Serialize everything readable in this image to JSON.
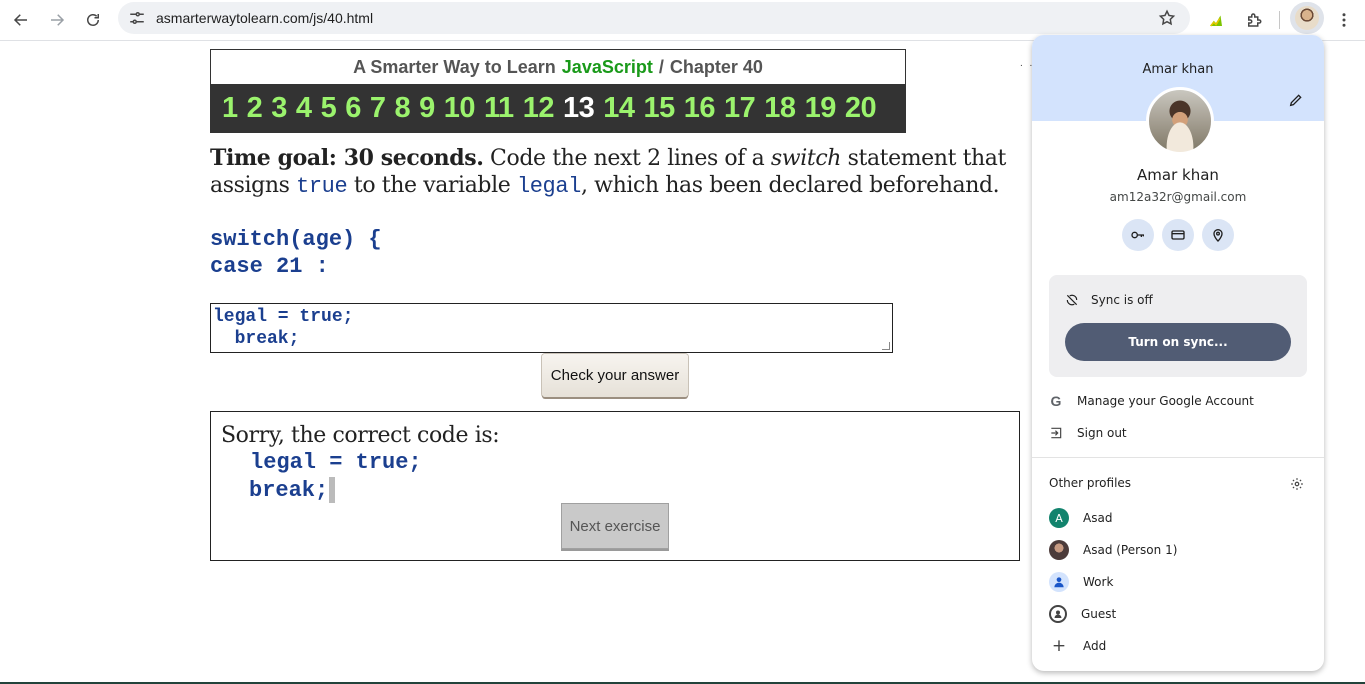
{
  "browser": {
    "url": "asmarterwaytolearn.com/js/40.html",
    "icons": [
      "back-icon",
      "forward-icon",
      "reload-icon",
      "site-info-icon",
      "bookmark-star-icon",
      "extension-icon",
      "puzzle-icon",
      "profile-avatar",
      "kebab-menu-icon"
    ]
  },
  "page": {
    "banner": {
      "prefix": "A Smarter Way to Learn",
      "highlight": "JavaScript",
      "separator": "/",
      "chapter": "Chapter 40"
    },
    "chapters": [
      "1",
      "2",
      "3",
      "4",
      "5",
      "6",
      "7",
      "8",
      "9",
      "10",
      "11",
      "12",
      "13",
      "14",
      "15",
      "16",
      "17",
      "18",
      "19",
      "20"
    ],
    "current_chapter": "13",
    "instructions": {
      "goal": "Time goal: 30 seconds.",
      "text1": " Code the next 2 lines of a ",
      "italic": "switch",
      "text2": " statement that assigns ",
      "code1": "true",
      "text3": " to the variable ",
      "code2": "legal",
      "text4": ", which has been declared beforehand."
    },
    "code_lines": [
      "switch(age) {",
      "case 21 :"
    ],
    "answer": {
      "line1": "legal = true;",
      "line2": "  break;"
    },
    "check_button": "Check your answer",
    "feedback": {
      "sorry": "Sorry, the correct code is:",
      "line1": "legal = true;",
      "line2": "break;",
      "next_button": "Next exercise"
    },
    "dots": ". . ."
  },
  "profile_panel": {
    "header_name": "Amar khan",
    "name": "Amar khan",
    "email": "am12a32r@gmail.com",
    "quick_actions": [
      "password-key-icon",
      "payment-card-icon",
      "address-pin-icon"
    ],
    "sync_status": "Sync is off",
    "sync_button": "Turn on sync...",
    "manage_account": "Manage your Google Account",
    "sign_out": "Sign out",
    "other_profiles_title": "Other profiles",
    "profiles": [
      {
        "label": "Asad",
        "initial": "A"
      },
      {
        "label": "Asad (Person 1)"
      },
      {
        "label": "Work"
      },
      {
        "label": "Guest"
      },
      {
        "label": "Add"
      }
    ]
  }
}
